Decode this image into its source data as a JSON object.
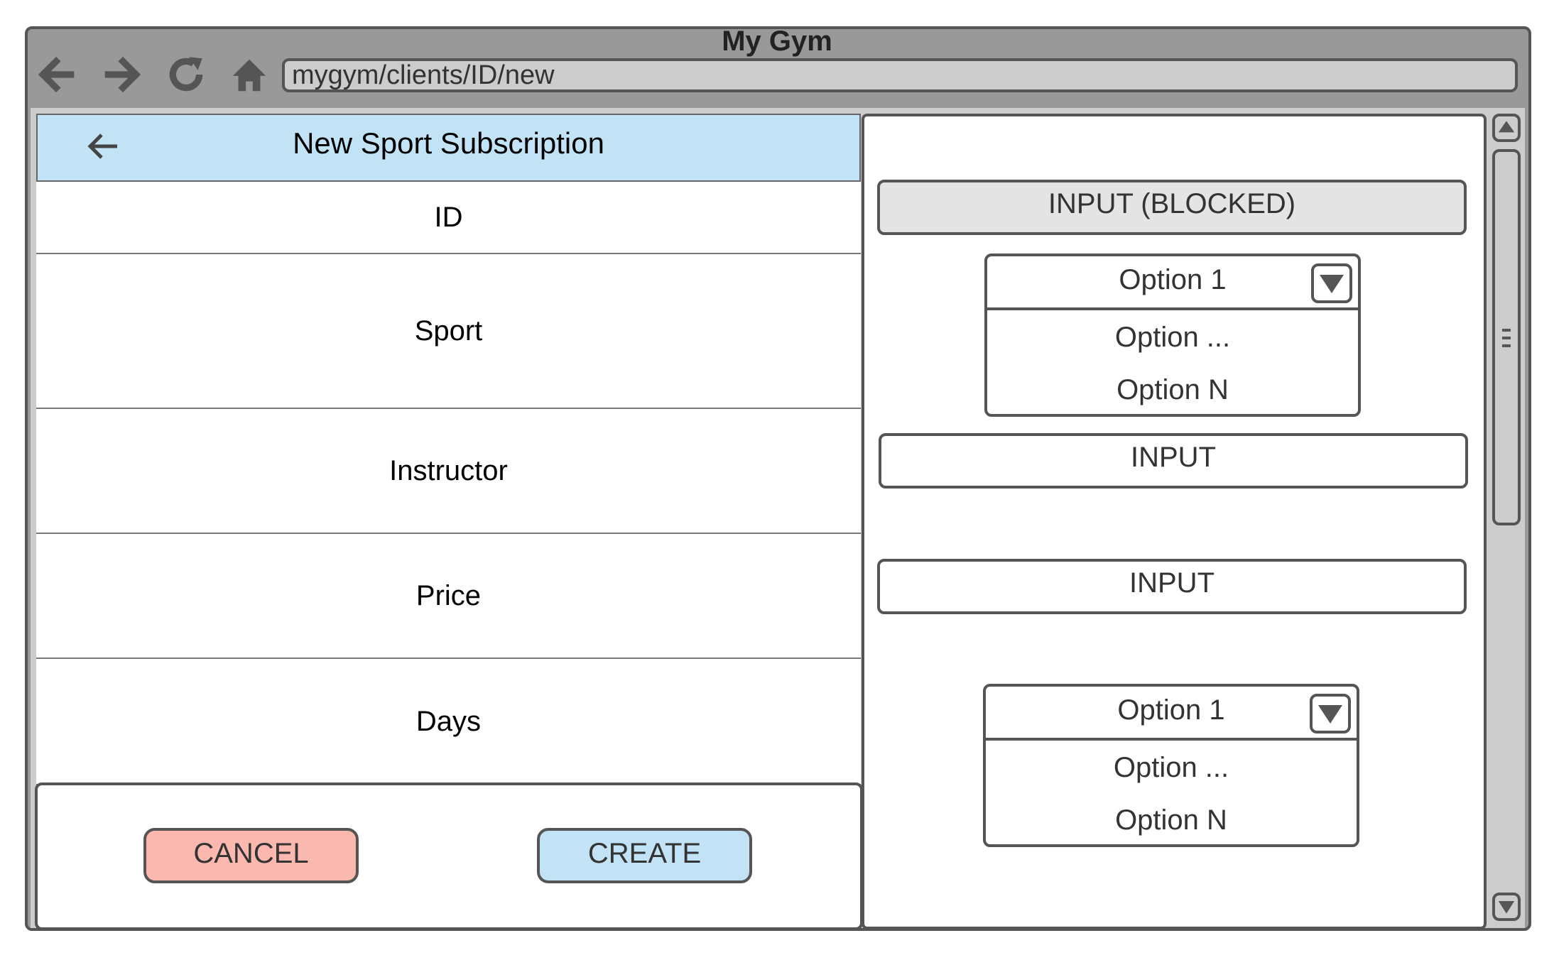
{
  "window": {
    "title": "My Gym"
  },
  "toolbar": {
    "icons": [
      "back-arrow-icon",
      "forward-arrow-icon",
      "refresh-icon",
      "home-icon"
    ],
    "address": "mygym/clients/ID/new"
  },
  "form": {
    "title": "New Sport Subscription",
    "back_icon": "left-arrow-icon",
    "rows": [
      {
        "label": "ID"
      },
      {
        "label": "Sport"
      },
      {
        "label": "Instructor"
      },
      {
        "label": "Price"
      },
      {
        "label": "Days"
      }
    ],
    "buttons": {
      "cancel": "CANCEL",
      "create": "CREATE"
    }
  },
  "fields": {
    "id": {
      "value": "INPUT (BLOCKED)",
      "state": "disabled"
    },
    "sport": {
      "selected": "Option 1",
      "options": [
        "Option ...",
        "Option N"
      ]
    },
    "instructor": {
      "value": "INPUT"
    },
    "price": {
      "value": "INPUT"
    },
    "days": {
      "selected": "Option 1",
      "options": [
        "Option ...",
        "Option N"
      ]
    }
  },
  "colors": {
    "header_bg": "#c1e3f5",
    "cancel_bg": "#fbb8ae",
    "create_bg": "#c1e3f5",
    "chrome": "#999999",
    "border": "#555555"
  }
}
